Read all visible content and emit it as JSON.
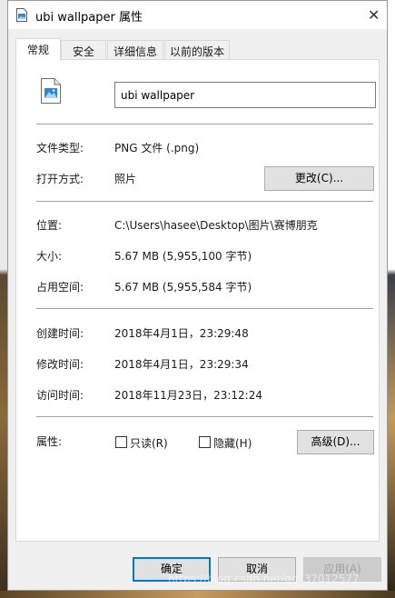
{
  "window": {
    "title": "ubi wallpaper 属性",
    "close_icon": "close-icon"
  },
  "tabs": [
    {
      "label": "常规",
      "active": true
    },
    {
      "label": "安全",
      "active": false
    },
    {
      "label": "详细信息",
      "active": false
    },
    {
      "label": "以前的版本",
      "active": false
    }
  ],
  "file": {
    "name": "ubi wallpaper",
    "icon": "image-file-icon"
  },
  "details": {
    "type_label": "文件类型:",
    "type_value": "PNG 文件 (.png)",
    "open_label": "打开方式:",
    "open_value": "照片",
    "change_button": "更改(C)...",
    "location_label": "位置:",
    "location_value": "C:\\Users\\hasee\\Desktop\\图片\\赛博朋克",
    "size_label": "大小:",
    "size_value": "5.67 MB (5,955,100 字节)",
    "disk_label": "占用空间:",
    "disk_value": "5.67 MB (5,955,584 字节)",
    "created_label": "创建时间:",
    "created_value": "2018年4月1日，23:29:48",
    "modified_label": "修改时间:",
    "modified_value": "2018年4月1日，23:29:34",
    "accessed_label": "访问时间:",
    "accessed_value": "2018年11月23日，23:12:24",
    "attr_label": "属性:",
    "readonly_label": "只读(R)",
    "hidden_label": "隐藏(H)",
    "advanced_button": "高级(D)..."
  },
  "footer": {
    "ok": "确定",
    "cancel": "取消",
    "apply": "应用(A)"
  },
  "watermark": "https://blog.csdn.net/qq_37012577",
  "colors": {
    "accent": "#0078d7",
    "dialog_bg": "#f0f0f0",
    "panel_bg": "#ffffff"
  }
}
